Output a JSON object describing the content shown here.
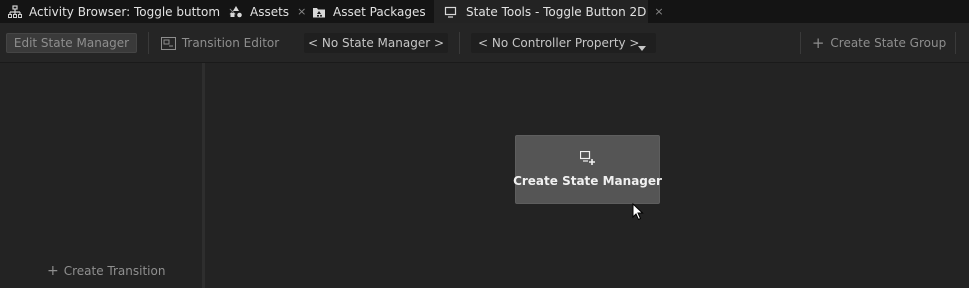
{
  "tabs": [
    {
      "label": "Activity Browser: Toggle buttom",
      "icon": "hierarchy-icon",
      "closable": true
    },
    {
      "label": "Assets",
      "icon": "assets-icon",
      "closable": true
    },
    {
      "label": "Asset Packages",
      "icon": "asset-packages-icon",
      "closable": true
    },
    {
      "label": "State Tools - Toggle Button 2D",
      "icon": "state-tools-icon",
      "closable": true,
      "active": true
    }
  ],
  "tab_close_glyph": "×",
  "toolbar": {
    "edit_state_manager": "Edit State Manager",
    "transition_editor": "Transition Editor",
    "state_manager_select": "< No State Manager >",
    "controller_property_select": "< No Controller Property >",
    "create_state_group": "Create State Group",
    "plus_glyph": "+"
  },
  "left_panel": {
    "create_transition": "Create Transition",
    "plus_glyph": "+"
  },
  "main": {
    "create_state_manager": "Create State Manager"
  },
  "colors": {
    "background": "#222222",
    "tabbar": "#141414",
    "toolbar": "#252525",
    "primary_button": "#555555"
  }
}
